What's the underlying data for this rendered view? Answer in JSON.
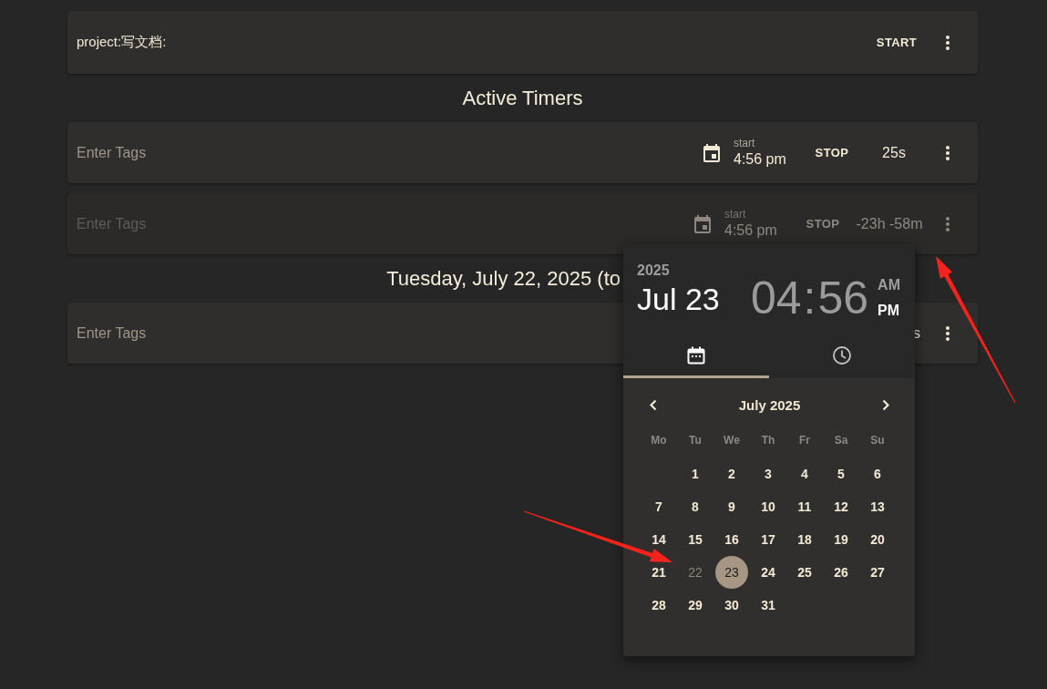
{
  "projects": [
    {
      "name": "project:写文档:",
      "action": "START"
    }
  ],
  "active_timers": {
    "title": "Active Timers",
    "timers": [
      {
        "placeholder": "Enter Tags",
        "start_label": "start",
        "start_time": "4:56 pm",
        "action": "STOP",
        "duration": "25s",
        "disabled": false
      },
      {
        "placeholder": "Enter Tags",
        "start_label": "start",
        "start_time": "4:56 pm",
        "action": "STOP",
        "duration": "-23h -58m",
        "disabled": true
      }
    ]
  },
  "day_groups": [
    {
      "title": "Tuesday, July 22, 2025 (to",
      "entries": [
        {
          "placeholder": "Enter Tags",
          "duration": "s"
        }
      ]
    }
  ],
  "date_picker": {
    "year": "2025",
    "date": "Jul 23",
    "hours": "04",
    "separator": ":",
    "minutes": "56",
    "periods": [
      {
        "label": "AM",
        "selected": false
      },
      {
        "label": "PM",
        "selected": true
      }
    ],
    "tabs": [
      {
        "kind": "calendar",
        "selected": true
      },
      {
        "kind": "clock",
        "selected": false
      }
    ],
    "month": "July 2025",
    "weekdays": [
      "Mo",
      "Tu",
      "We",
      "Th",
      "Fr",
      "Sa",
      "Su"
    ],
    "weeks": [
      {
        "days": [
          {
            "label": "1",
            "selected": false,
            "disabled": false
          },
          {
            "label": "2",
            "selected": false,
            "disabled": false
          },
          {
            "label": "3",
            "selected": false,
            "disabled": false
          },
          {
            "label": "4",
            "selected": false,
            "disabled": false
          },
          {
            "label": "5",
            "selected": false,
            "disabled": false
          },
          {
            "label": "6",
            "selected": false,
            "disabled": false
          }
        ]
      },
      {
        "days": [
          {
            "label": "7",
            "selected": false,
            "disabled": false
          },
          {
            "label": "8",
            "selected": false,
            "disabled": false
          },
          {
            "label": "9",
            "selected": false,
            "disabled": false
          },
          {
            "label": "10",
            "selected": false,
            "disabled": false
          },
          {
            "label": "11",
            "selected": false,
            "disabled": false
          },
          {
            "label": "12",
            "selected": false,
            "disabled": false
          },
          {
            "label": "13",
            "selected": false,
            "disabled": false
          }
        ]
      },
      {
        "days": [
          {
            "label": "14",
            "selected": false,
            "disabled": false
          },
          {
            "label": "15",
            "selected": false,
            "disabled": false
          },
          {
            "label": "16",
            "selected": false,
            "disabled": false
          },
          {
            "label": "17",
            "selected": false,
            "disabled": false
          },
          {
            "label": "18",
            "selected": false,
            "disabled": false
          },
          {
            "label": "19",
            "selected": false,
            "disabled": false
          },
          {
            "label": "20",
            "selected": false,
            "disabled": false
          }
        ]
      },
      {
        "days": [
          {
            "label": "21",
            "selected": false,
            "disabled": false
          },
          {
            "label": "22",
            "selected": false,
            "disabled": true
          },
          {
            "label": "23",
            "selected": true,
            "disabled": false
          },
          {
            "label": "24",
            "selected": false,
            "disabled": false
          },
          {
            "label": "25",
            "selected": false,
            "disabled": false
          },
          {
            "label": "26",
            "selected": false,
            "disabled": false
          },
          {
            "label": "27",
            "selected": false,
            "disabled": false
          }
        ]
      },
      {
        "days": [
          {
            "label": "28",
            "selected": false,
            "disabled": false
          },
          {
            "label": "29",
            "selected": false,
            "disabled": false
          },
          {
            "label": "30",
            "selected": false,
            "disabled": false
          },
          {
            "label": "31",
            "selected": false,
            "disabled": false
          }
        ]
      }
    ]
  },
  "annotations": [
    {
      "kind": "arrow"
    },
    {
      "kind": "arrow"
    }
  ]
}
